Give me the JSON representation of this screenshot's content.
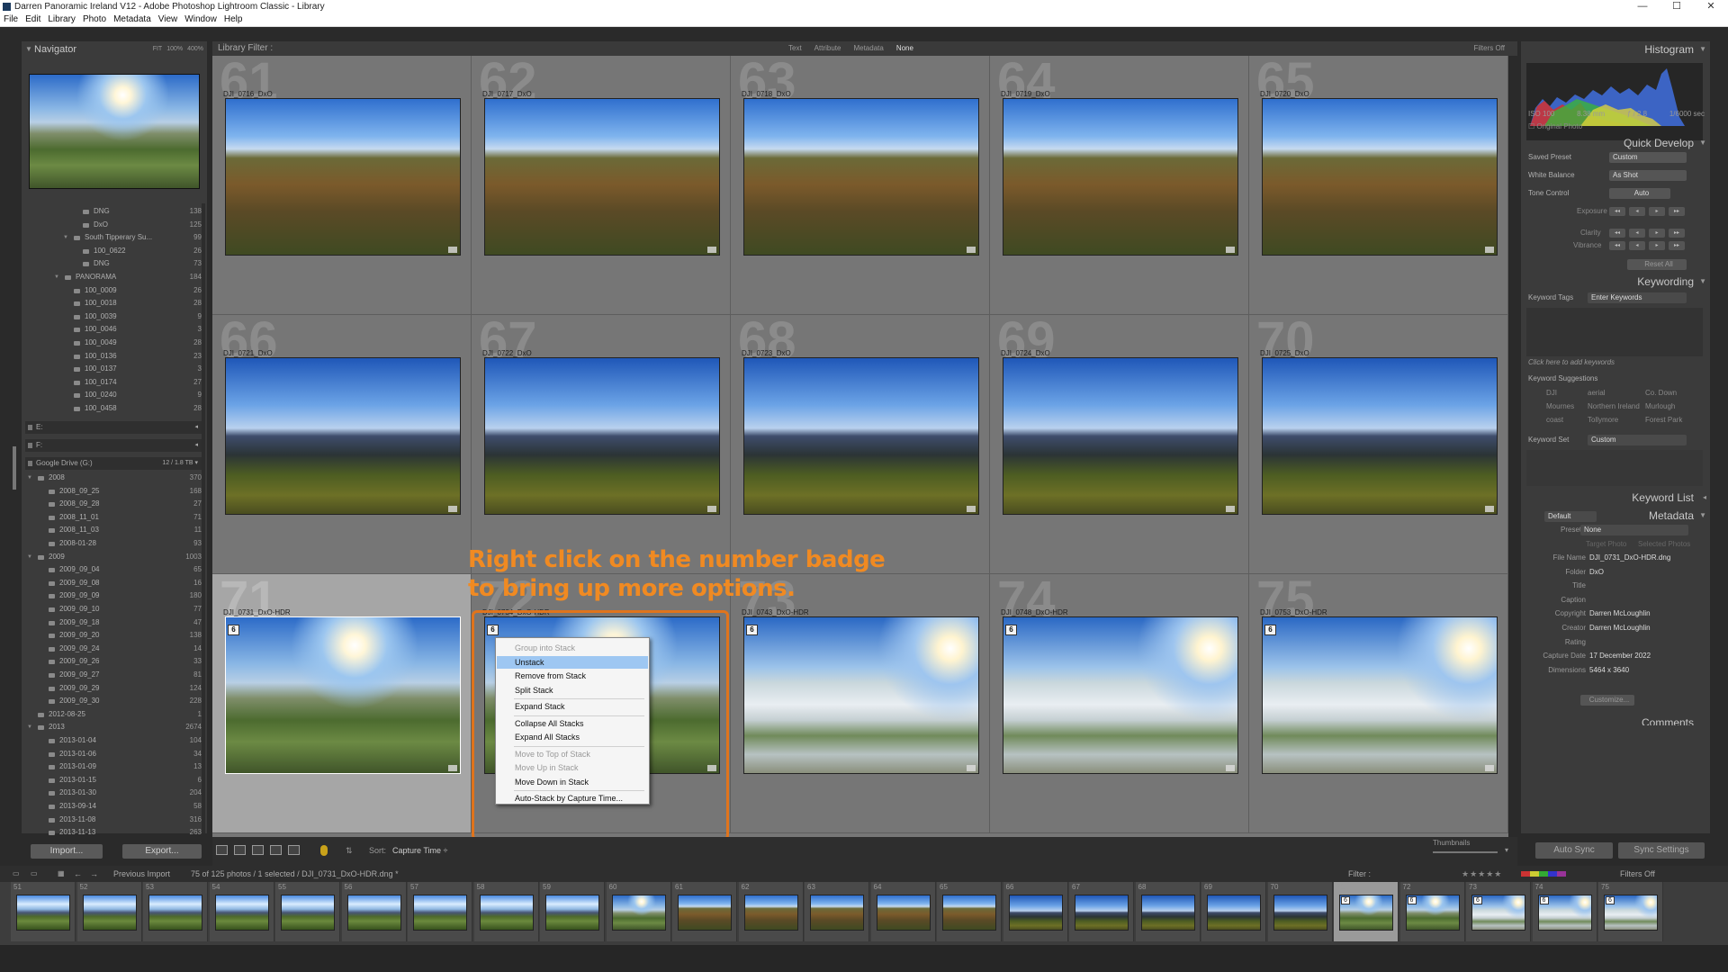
{
  "window": {
    "title": "Darren Panoramic Ireland V12 - Adobe Photoshop Lightroom Classic - Library",
    "min": "—",
    "max": "☐",
    "close": "✕"
  },
  "menu": [
    "File",
    "Edit",
    "Library",
    "Photo",
    "Metadata",
    "View",
    "Window",
    "Help"
  ],
  "navigator": {
    "title": "Navigator",
    "opts": [
      "FIT",
      "100%",
      "400%"
    ]
  },
  "folders": [
    {
      "name": "DNG",
      "count": "138",
      "depth": 3
    },
    {
      "name": "DxO",
      "count": "125",
      "depth": 3
    },
    {
      "name": "South Tipperary Su...",
      "count": "99",
      "depth": 2,
      "open": true
    },
    {
      "name": "100_0622",
      "count": "26",
      "depth": 3
    },
    {
      "name": "DNG",
      "count": "73",
      "depth": 3
    },
    {
      "name": "PANORAMA",
      "count": "184",
      "depth": 1,
      "open": true
    },
    {
      "name": "100_0009",
      "count": "26",
      "depth": 2
    },
    {
      "name": "100_0018",
      "count": "28",
      "depth": 2
    },
    {
      "name": "100_0039",
      "count": "9",
      "depth": 2
    },
    {
      "name": "100_0046",
      "count": "3",
      "depth": 2
    },
    {
      "name": "100_0049",
      "count": "28",
      "depth": 2
    },
    {
      "name": "100_0136",
      "count": "23",
      "depth": 2
    },
    {
      "name": "100_0137",
      "count": "3",
      "depth": 2
    },
    {
      "name": "100_0174",
      "count": "27",
      "depth": 2
    },
    {
      "name": "100_0240",
      "count": "9",
      "depth": 2
    },
    {
      "name": "100_0458",
      "count": "28",
      "depth": 2
    }
  ],
  "drives": [
    {
      "name": "E:",
      "right": "◂"
    },
    {
      "name": "F:",
      "right": "◂"
    },
    {
      "name": "Google Drive (G:)",
      "right": "12 / 1.8 TB ▾"
    }
  ],
  "gfolders": [
    {
      "name": "2008",
      "count": "370",
      "depth": 0,
      "open": true
    },
    {
      "name": "2008_09_25",
      "count": "168",
      "depth": 1
    },
    {
      "name": "2008_09_28",
      "count": "27",
      "depth": 1
    },
    {
      "name": "2008_11_01",
      "count": "71",
      "depth": 1
    },
    {
      "name": "2008_11_03",
      "count": "11",
      "depth": 1
    },
    {
      "name": "2008-01-28",
      "count": "93",
      "depth": 1
    },
    {
      "name": "2009",
      "count": "1003",
      "depth": 0,
      "open": true
    },
    {
      "name": "2009_09_04",
      "count": "65",
      "depth": 1
    },
    {
      "name": "2009_09_08",
      "count": "16",
      "depth": 1
    },
    {
      "name": "2009_09_09",
      "count": "180",
      "depth": 1
    },
    {
      "name": "2009_09_10",
      "count": "77",
      "depth": 1
    },
    {
      "name": "2009_09_18",
      "count": "47",
      "depth": 1
    },
    {
      "name": "2009_09_20",
      "count": "138",
      "depth": 1
    },
    {
      "name": "2009_09_24",
      "count": "14",
      "depth": 1
    },
    {
      "name": "2009_09_26",
      "count": "33",
      "depth": 1
    },
    {
      "name": "2009_09_27",
      "count": "81",
      "depth": 1
    },
    {
      "name": "2009_09_29",
      "count": "124",
      "depth": 1
    },
    {
      "name": "2009_09_30",
      "count": "228",
      "depth": 1
    },
    {
      "name": "2012-08-25",
      "count": "1",
      "depth": 0
    },
    {
      "name": "2013",
      "count": "2674",
      "depth": 0,
      "open": true
    },
    {
      "name": "2013-01-04",
      "count": "104",
      "depth": 1
    },
    {
      "name": "2013-01-06",
      "count": "34",
      "depth": 1
    },
    {
      "name": "2013-01-09",
      "count": "13",
      "depth": 1
    },
    {
      "name": "2013-01-15",
      "count": "6",
      "depth": 1
    },
    {
      "name": "2013-01-30",
      "count": "204",
      "depth": 1
    },
    {
      "name": "2013-09-14",
      "count": "58",
      "depth": 1
    },
    {
      "name": "2013-11-08",
      "count": "316",
      "depth": 1
    },
    {
      "name": "2013-11-13",
      "count": "263",
      "depth": 1
    }
  ],
  "buttons": {
    "import": "Import...",
    "export": "Export..."
  },
  "filter": {
    "label": "Library Filter :",
    "opts": [
      "Text",
      "Attribute",
      "Metadata",
      "None"
    ],
    "selected": "None",
    "filters_off": "Filters Off"
  },
  "grid": [
    {
      "num": "61",
      "name": "DJI_0716_DxO",
      "style": "pa"
    },
    {
      "num": "62",
      "name": "DJI_0717_DxO",
      "style": "pa"
    },
    {
      "num": "63",
      "name": "DJI_0718_DxO",
      "style": "pa"
    },
    {
      "num": "64",
      "name": "DJI_0719_DxO",
      "style": "pa"
    },
    {
      "num": "65",
      "name": "DJI_0720_DxO",
      "style": "pa"
    },
    {
      "num": "66",
      "name": "DJI_0721_DxO",
      "style": "pb"
    },
    {
      "num": "67",
      "name": "DJI_0722_DxO",
      "style": "pb"
    },
    {
      "num": "68",
      "name": "DJI_0723_DxO",
      "style": "pb"
    },
    {
      "num": "69",
      "name": "DJI_0724_DxO",
      "style": "pb"
    },
    {
      "num": "70",
      "name": "DJI_0725_DxO",
      "style": "pb"
    },
    {
      "num": "71",
      "name": "DJI_0731_DxO-HDR",
      "style": "pd",
      "badge": "6",
      "selected": true
    },
    {
      "num": "72",
      "name": "DJI_0734_DxO-HDR",
      "style": "pd",
      "badge": "6"
    },
    {
      "num": "73",
      "name": "DJI_0743_DxO-HDR",
      "style": "pe",
      "badge": "6"
    },
    {
      "num": "74",
      "name": "DJI_0748_DxO-HDR",
      "style": "pe",
      "badge": "6"
    },
    {
      "num": "75",
      "name": "DJI_0753_DxO-HDR",
      "style": "pe",
      "badge": "6"
    }
  ],
  "annotation": {
    "line1": "Right click on the number badge",
    "line2": "to bring up more options."
  },
  "context_menu": [
    {
      "label": "Group into Stack",
      "disabled": true
    },
    {
      "label": "Unstack",
      "highlighted": true
    },
    {
      "label": "Remove from Stack"
    },
    {
      "label": "Split Stack"
    },
    {
      "sep": true
    },
    {
      "label": "Expand Stack"
    },
    {
      "sep": true
    },
    {
      "label": "Collapse All Stacks"
    },
    {
      "label": "Expand All Stacks"
    },
    {
      "sep": true
    },
    {
      "label": "Move to Top of Stack",
      "disabled": true
    },
    {
      "label": "Move Up in Stack",
      "disabled": true
    },
    {
      "label": "Move Down in Stack"
    },
    {
      "sep": true
    },
    {
      "label": "Auto-Stack by Capture Time..."
    }
  ],
  "toolbar": {
    "sort_label": "Sort:",
    "sort_value": "Capture Time ÷",
    "thumbs_label": "Thumbnails"
  },
  "right": {
    "histogram": "Histogram",
    "hinfo": [
      "ISO 100",
      "8.38 mm",
      "ƒ / 2.8",
      "1/6000 sec"
    ],
    "original": "Original Photo",
    "quick": "Quick Develop",
    "saved_preset": "Saved Preset",
    "saved_preset_val": "Custom",
    "wb": "White Balance",
    "wb_val": "As Shot",
    "tone": "Tone Control",
    "auto": "Auto",
    "exposure": "Exposure",
    "clarity": "Clarity",
    "vibrance": "Vibrance",
    "reset": "Reset All",
    "keywording": "Keywording",
    "kwtags": "Keyword Tags",
    "kwtags_val": "Enter Keywords",
    "kwhint": "Click here to add keywords",
    "kwsugg": "Keyword Suggestions",
    "kwsugg_items": [
      "DJI",
      "aerial",
      "Co. Down",
      "Mournes",
      "Northern Ireland",
      "Murlough",
      "coast",
      "Tollymore",
      "Forest Park"
    ],
    "kwset": "Keyword Set",
    "kwset_val": "Custom",
    "kwlist": "Keyword List",
    "metadata": "Metadata",
    "meta_default": "Default",
    "preset": "Preset",
    "preset_val": "None",
    "target": "Target Photo",
    "selected": "Selected Photos",
    "meta": [
      {
        "k": "File Name",
        "v": "DJI_0731_DxO-HDR.dng"
      },
      {
        "k": "Folder",
        "v": "DxO"
      },
      {
        "k": "Title",
        "v": ""
      },
      {
        "k": "Caption",
        "v": ""
      },
      {
        "k": "Copyright",
        "v": "Darren McLoughlin"
      },
      {
        "k": "Creator",
        "v": "Darren McLoughlin"
      },
      {
        "k": "Rating",
        "v": ""
      },
      {
        "k": "Capture Date",
        "v": "17 December 2022"
      },
      {
        "k": "Dimensions",
        "v": "5464 x 3640"
      }
    ],
    "customize": "Customize...",
    "comments": "Comments",
    "autosync": "Auto Sync",
    "syncsettings": "Sync Settings"
  },
  "filmbar": {
    "prev": "Previous Import",
    "status": "75 of 125 photos / 1 selected / DJI_0731_DxO-HDR.dng *",
    "filter": "Filter :",
    "filters_off": "Filters Off"
  },
  "filmstrip": [
    {
      "n": "51",
      "s": "pc"
    },
    {
      "n": "52",
      "s": "pc"
    },
    {
      "n": "53",
      "s": "pc"
    },
    {
      "n": "54",
      "s": "pc"
    },
    {
      "n": "55",
      "s": "pc"
    },
    {
      "n": "56",
      "s": "pc"
    },
    {
      "n": "57",
      "s": "pc"
    },
    {
      "n": "58",
      "s": "pc"
    },
    {
      "n": "59",
      "s": "pc"
    },
    {
      "n": "60",
      "s": "pd"
    },
    {
      "n": "61",
      "s": "pa"
    },
    {
      "n": "62",
      "s": "pa"
    },
    {
      "n": "63",
      "s": "pa"
    },
    {
      "n": "64",
      "s": "pa"
    },
    {
      "n": "65",
      "s": "pa"
    },
    {
      "n": "66",
      "s": "pb"
    },
    {
      "n": "67",
      "s": "pb"
    },
    {
      "n": "68",
      "s": "pb"
    },
    {
      "n": "69",
      "s": "pb"
    },
    {
      "n": "70",
      "s": "pb"
    },
    {
      "n": "71",
      "s": "pd",
      "b": "6",
      "sel": true
    },
    {
      "n": "72",
      "s": "pd",
      "b": "6"
    },
    {
      "n": "73",
      "s": "pe",
      "b": "6"
    },
    {
      "n": "74",
      "s": "pe",
      "b": "6"
    },
    {
      "n": "75",
      "s": "pe",
      "b": "6"
    }
  ]
}
